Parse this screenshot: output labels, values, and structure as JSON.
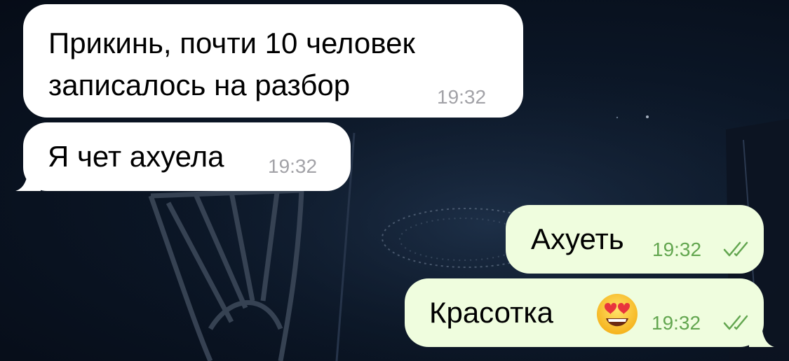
{
  "messages": [
    {
      "direction": "incoming",
      "lines": [
        "Прикинь, почти 10 человек",
        "записалось на разбор"
      ],
      "time": "19:32"
    },
    {
      "direction": "incoming",
      "text": "Я чет ахуела",
      "time": "19:32"
    },
    {
      "direction": "outgoing",
      "text": "Ахуеть",
      "time": "19:32",
      "status_icon": "double-check-icon"
    },
    {
      "direction": "outgoing",
      "text": "Красотка",
      "emoji_icon": "heart-eyes-emoji-icon",
      "time": "19:32",
      "status_icon": "double-check-icon"
    }
  ],
  "colors": {
    "incoming_bubble": "#ffffff",
    "outgoing_bubble": "#effdde",
    "incoming_time": "#a2a2a7",
    "outgoing_time": "#63a650",
    "background": "#0b1626"
  }
}
